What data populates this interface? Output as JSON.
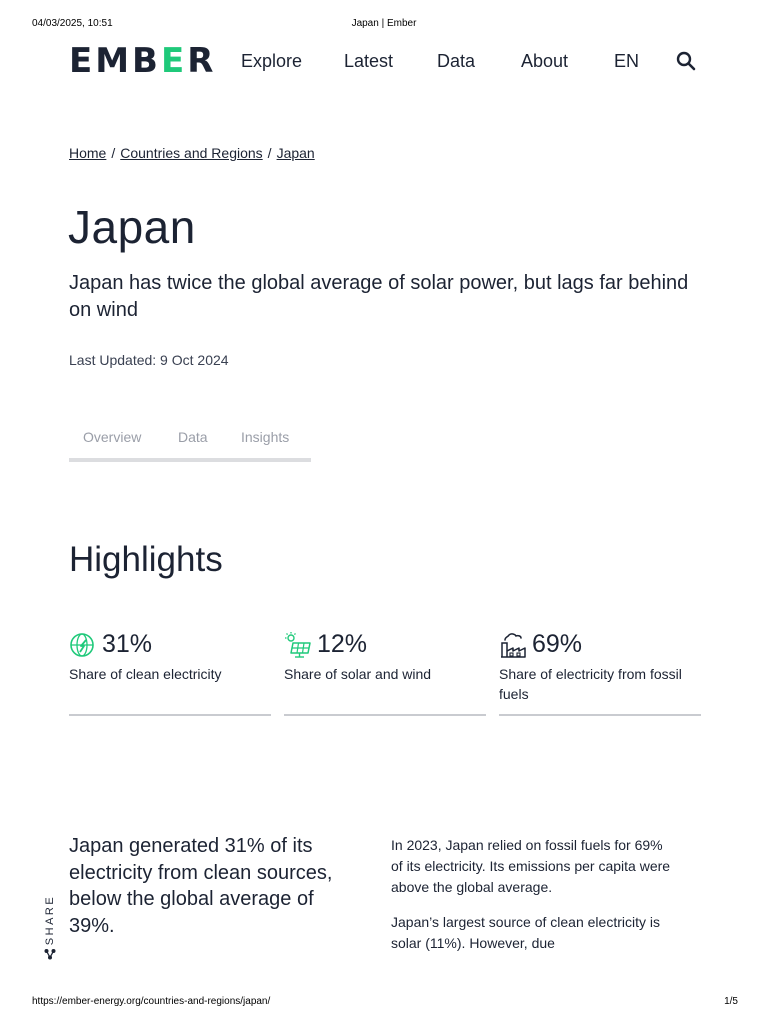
{
  "print_header": {
    "datetime": "04/03/2025, 10:51",
    "page_title": "Japan | Ember"
  },
  "nav": {
    "logo_text": "EMBER",
    "items": [
      {
        "label": "Explore"
      },
      {
        "label": "Latest"
      },
      {
        "label": "Data"
      },
      {
        "label": "About"
      },
      {
        "label": "EN"
      }
    ],
    "search_icon": "search-icon"
  },
  "breadcrumb": {
    "items": [
      "Home",
      "Countries and Regions",
      "Japan"
    ],
    "separator": "/"
  },
  "page": {
    "title": "Japan",
    "subtitle": "Japan has twice the global average of solar power, but lags far behind on wind",
    "last_updated": "Last Updated: 9 Oct 2024"
  },
  "tabs": [
    {
      "label": "Overview"
    },
    {
      "label": "Data"
    },
    {
      "label": "Insights"
    }
  ],
  "highlights": {
    "title": "Highlights",
    "stats": [
      {
        "icon": "clean-energy-globe-icon",
        "value": "31%",
        "label": "Share of clean electricity"
      },
      {
        "icon": "solar-wind-icon",
        "value": "12%",
        "label": "Share of solar and wind"
      },
      {
        "icon": "fossil-factory-icon",
        "value": "69%",
        "label": "Share of electricity from fossil fuels"
      }
    ]
  },
  "summary": {
    "lead": "Japan generated 31% of its electricity from clean sources, below the global average of 39%.",
    "paragraphs": [
      "In 2023, Japan relied on fossil fuels for 69% of its electricity. Its emissions per capita were above the global average.",
      "Japan’s largest source of clean electricity is solar (11%). However, due"
    ]
  },
  "share": {
    "label": "SHARE",
    "icon": "share-icon"
  },
  "print_footer": {
    "url": "https://ember-energy.org/countries-and-regions/japan/",
    "page_count": "1/5"
  },
  "colors": {
    "text": "#1c2333",
    "brand_green": "#1fc97a",
    "tab_inactive": "#9a9ea8",
    "divider": "#c9cbd0"
  }
}
